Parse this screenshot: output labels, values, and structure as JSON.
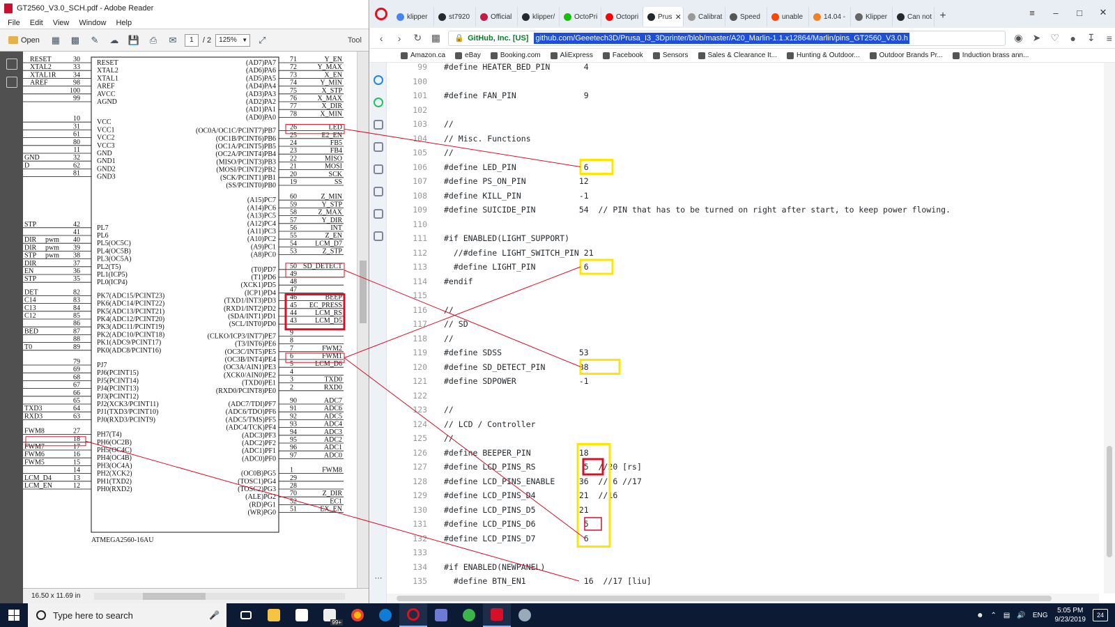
{
  "reader": {
    "title": "GT2560_V3.0_SCH.pdf - Adobe Reader",
    "menu": [
      "File",
      "Edit",
      "View",
      "Window",
      "Help"
    ],
    "open_label": "Open",
    "page_current": "1",
    "page_total": "/ 2",
    "zoom": "125%",
    "tools_label": "Tool",
    "page_size": "16.50 x 11.69 in",
    "chip_label": "ATMEGA2560-16AU",
    "left_pins": [
      {
        "num": "30",
        "name": "RESET"
      },
      {
        "num": "33",
        "name": "XTAL2"
      },
      {
        "num": "34",
        "name": "XTAL1"
      },
      {
        "num": "98",
        "name": "AREF"
      },
      {
        "num": "100",
        "name": "AVCC"
      },
      {
        "num": "99",
        "name": "AGND"
      },
      {
        "num": "10",
        "name": "VCC"
      },
      {
        "num": "31",
        "name": "VCC1"
      },
      {
        "num": "61",
        "name": "VCC2"
      },
      {
        "num": "80",
        "name": "VCC3"
      },
      {
        "num": "11",
        "name": "GND"
      },
      {
        "num": "32",
        "name": "GND1"
      },
      {
        "num": "62",
        "name": "GND2"
      },
      {
        "num": "81",
        "name": "GND3"
      },
      {
        "num": "42",
        "name": "PL7"
      },
      {
        "num": "41",
        "name": "PL6"
      },
      {
        "num": "40",
        "name": "PL5(OC5C)"
      },
      {
        "num": "39",
        "name": "PL4(OC5B)"
      },
      {
        "num": "38",
        "name": "PL3(OC5A)"
      },
      {
        "num": "37",
        "name": "PL2(T5)"
      },
      {
        "num": "36",
        "name": "PL1(ICP5)"
      },
      {
        "num": "35",
        "name": "PL0(ICP4)"
      },
      {
        "num": "82",
        "name": "PK7(ADC15/PCINT23)"
      },
      {
        "num": "83",
        "name": "PK6(ADC14/PCINT22)"
      },
      {
        "num": "84",
        "name": "PK5(ADC13/PCINT21)"
      },
      {
        "num": "85",
        "name": "PK4(ADC12/PCINT20)"
      },
      {
        "num": "86",
        "name": "PK3(ADC11/PCINT19)"
      },
      {
        "num": "87",
        "name": "PK2(ADC10/PCINT18)"
      },
      {
        "num": "88",
        "name": "PK1(ADC9/PCINT17)"
      },
      {
        "num": "89",
        "name": "PK0(ADC8/PCINT16)"
      },
      {
        "num": "79",
        "name": "PJ7"
      },
      {
        "num": "69",
        "name": "PJ6(PCINT15)"
      },
      {
        "num": "68",
        "name": "PJ5(PCINT14)"
      },
      {
        "num": "67",
        "name": "PJ4(PCINT13)"
      },
      {
        "num": "66",
        "name": "PJ3(PCINT12)"
      },
      {
        "num": "65",
        "name": "PJ2(XCK3/PCINT11)"
      },
      {
        "num": "64",
        "name": "PJ1(TXD3/PCINT10)"
      },
      {
        "num": "63",
        "name": "PJ0(RXD3/PCINT9)"
      },
      {
        "num": "27",
        "name": "PH7(T4)"
      },
      {
        "num": "18",
        "name": "PH6(OC2B)"
      },
      {
        "num": "17",
        "name": "PH5(OC4C)"
      },
      {
        "num": "16",
        "name": "PH4(OC4B)"
      },
      {
        "num": "15",
        "name": "PH3(OC4A)"
      },
      {
        "num": "14",
        "name": "PH2(XCK2)"
      },
      {
        "num": "13",
        "name": "PH1(TXD2)"
      },
      {
        "num": "12",
        "name": "PH0(RXD2)"
      }
    ],
    "far_left_labels": [
      "RESET",
      "XTAL2",
      "XTAL1R",
      "AREF",
      "GND",
      "D",
      "STP",
      "DIR",
      "DIR",
      "STP",
      "DIR",
      "EN",
      "STP",
      "DET",
      "C14",
      "C13",
      "C12",
      "BED",
      "T0",
      "TXD3",
      "RXD3",
      "FWM8",
      "FWM7",
      "FWM6",
      "FWM5",
      "LCM_D4",
      "LCM_EN"
    ],
    "pwm_labels": [
      "pwm",
      "pwm",
      "pwm"
    ],
    "right_pins": [
      {
        "num": "71",
        "name": "(AD7)PA7",
        "net": "Y_EN"
      },
      {
        "num": "72",
        "name": "(AD6)PA6",
        "net": "Y_MAX"
      },
      {
        "num": "73",
        "name": "(AD5)PA5",
        "net": "X_EN"
      },
      {
        "num": "74",
        "name": "(AD4)PA4",
        "net": "Y_MIN"
      },
      {
        "num": "75",
        "name": "(AD3)PA3",
        "net": "X_STP"
      },
      {
        "num": "76",
        "name": "(AD2)PA2",
        "net": "X_MAX"
      },
      {
        "num": "77",
        "name": "(AD1)PA1",
        "net": "X_DIR"
      },
      {
        "num": "78",
        "name": "(AD0)PA0",
        "net": "X_MIN"
      },
      {
        "num": "26",
        "name": "(OC0A/OC1C/PCINT7)PB7",
        "net": "LED"
      },
      {
        "num": "25",
        "name": "(OC1B/PCINT6)PB6",
        "net": "E2_EN"
      },
      {
        "num": "24",
        "name": "(OC1A/PCINT5)PB5",
        "net": "FB5"
      },
      {
        "num": "23",
        "name": "(OC2A/PCINT4)PB4",
        "net": "FB4"
      },
      {
        "num": "22",
        "name": "(MISO/PCINT3)PB3",
        "net": "MISO"
      },
      {
        "num": "21",
        "name": "(MOSI/PCINT2)PB2",
        "net": "MOSI"
      },
      {
        "num": "20",
        "name": "(SCK/PCINT1)PB1",
        "net": "SCK"
      },
      {
        "num": "19",
        "name": "(SS/PCINT0)PB0",
        "net": "SS"
      },
      {
        "num": "60",
        "name": "(A15)PC7",
        "net": "Z_MIN"
      },
      {
        "num": "59",
        "name": "(A14)PC6",
        "net": "Y_STP"
      },
      {
        "num": "58",
        "name": "(A13)PC5",
        "net": "Z_MAX"
      },
      {
        "num": "57",
        "name": "(A12)PC4",
        "net": "Y_DIR"
      },
      {
        "num": "56",
        "name": "(A11)PC3",
        "net": "INT"
      },
      {
        "num": "55",
        "name": "(A10)PC2",
        "net": "Z_EN"
      },
      {
        "num": "54",
        "name": "(A9)PC1",
        "net": "LCM_D7"
      },
      {
        "num": "53",
        "name": "(A8)PC0",
        "net": "Z_STP"
      },
      {
        "num": "50",
        "name": "(T0)PD7",
        "net": "SD_DETECT"
      },
      {
        "num": "49",
        "name": "(T1)PD6",
        "net": ""
      },
      {
        "num": "48",
        "name": "(XCK1)PD5",
        "net": ""
      },
      {
        "num": "47",
        "name": "(ICP1)PD4",
        "net": ""
      },
      {
        "num": "46",
        "name": "(TXD1/INT3)PD3",
        "net": "BEEP"
      },
      {
        "num": "45",
        "name": "(RXD1/INT2)PD2",
        "net": "EC_PRESS"
      },
      {
        "num": "44",
        "name": "(SDA/INT1)PD1",
        "net": "LCM_RS"
      },
      {
        "num": "43",
        "name": "(SCL/INT0)PD0",
        "net": "LCM_D5"
      },
      {
        "num": "9",
        "name": "(CLKO/ICP3/INT7)PE7",
        "net": ""
      },
      {
        "num": "8",
        "name": "(T3/INT6)PE6",
        "net": ""
      },
      {
        "num": "7",
        "name": "(OC3C/INT5)PE5",
        "net": "FWM2"
      },
      {
        "num": "6",
        "name": "(OC3B/INT4)PE4",
        "net": "FWM1"
      },
      {
        "num": "5",
        "name": "(OC3A/AIN1)PE3",
        "net": "LCM_D6"
      },
      {
        "num": "4",
        "name": "(XCK0/AIN0)PE2",
        "net": ""
      },
      {
        "num": "3",
        "name": "(TXD0)PE1",
        "net": "TXD0"
      },
      {
        "num": "2",
        "name": "(RXD0/PCINT8)PE0",
        "net": "RXD0"
      },
      {
        "num": "90",
        "name": "(ADC7/TDI)PF7",
        "net": "ADC7"
      },
      {
        "num": "91",
        "name": "(ADC6/TDO)PF6",
        "net": "ADC6"
      },
      {
        "num": "92",
        "name": "(ADC5/TMS)PF5",
        "net": "ADC5"
      },
      {
        "num": "93",
        "name": "(ADC4/TCK)PF4",
        "net": "ADC4"
      },
      {
        "num": "94",
        "name": "(ADC3)PF3",
        "net": "ADC3"
      },
      {
        "num": "95",
        "name": "(ADC2)PF2",
        "net": "ADC2"
      },
      {
        "num": "96",
        "name": "(ADC1)PF1",
        "net": "ADC1"
      },
      {
        "num": "97",
        "name": "(ADC0)PF0",
        "net": "ADC0"
      },
      {
        "num": "1",
        "name": "(OC0B)PG5",
        "net": "FWM8"
      },
      {
        "num": "29",
        "name": "(TOSC1)PG4",
        "net": ""
      },
      {
        "num": "28",
        "name": "(TOSC2)PG3",
        "net": ""
      },
      {
        "num": "70",
        "name": "(ALE)PG2",
        "net": "Z_DIR"
      },
      {
        "num": "52",
        "name": "(RD)PG1",
        "net": "EC1"
      },
      {
        "num": "51",
        "name": "(WR)PG0",
        "net": "EX_EN"
      }
    ]
  },
  "browser": {
    "tabs": [
      {
        "label": "klipper",
        "color": "#4285f4"
      },
      {
        "label": "st7920",
        "color": "#24292e"
      },
      {
        "label": "Official",
        "color": "#c51a4a"
      },
      {
        "label": "klipper/",
        "color": "#24292e"
      },
      {
        "label": "OctoPri",
        "color": "#13c100"
      },
      {
        "label": "Octopri",
        "color": "#ff0000"
      },
      {
        "label": "Prus",
        "color": "#24292e",
        "active": true
      },
      {
        "label": "Calibrat",
        "color": "#999999"
      },
      {
        "label": "Speed",
        "color": "#555555"
      },
      {
        "label": "unable",
        "color": "#ff4500"
      },
      {
        "label": "14.04 -",
        "color": "#f48024"
      },
      {
        "label": "Klipper",
        "color": "#666666"
      },
      {
        "label": "Can not",
        "color": "#24292e"
      }
    ],
    "cert_label": "GitHub, Inc. [US]",
    "url": "github.com/Geeetech3D/Prusa_I3_3Dprinter/blob/master/A20_Marlin-1.1.x12864/Marlin/pins_GT2560_V3.0.h",
    "bookmarks": [
      "Amazon.ca",
      "eBay",
      "Booking.com",
      "AliExpress",
      "Facebook",
      "Sensors",
      "Sales & Clearance It...",
      "Hunting & Outdoor...",
      "Outdoor Brands Pr...",
      "Induction brass ann..."
    ],
    "code_lines": [
      {
        "n": "99",
        "text": "#define HEATER_BED_PIN       4"
      },
      {
        "n": "100",
        "text": ""
      },
      {
        "n": "101",
        "text": "#define FAN_PIN              9"
      },
      {
        "n": "102",
        "text": ""
      },
      {
        "n": "103",
        "text": "//"
      },
      {
        "n": "104",
        "text": "// Misc. Functions"
      },
      {
        "n": "105",
        "text": "//"
      },
      {
        "n": "106",
        "text": "#define LED_PIN              6"
      },
      {
        "n": "107",
        "text": "#define PS_ON_PIN           12"
      },
      {
        "n": "108",
        "text": "#define KILL_PIN            -1"
      },
      {
        "n": "109",
        "text": "#define SUICIDE_PIN         54  // PIN that has to be turned on right after start, to keep power flowing."
      },
      {
        "n": "110",
        "text": ""
      },
      {
        "n": "111",
        "text": "#if ENABLED(LIGHT_SUPPORT)"
      },
      {
        "n": "112",
        "text": "  //#define LIGHT_SWITCH_PIN 21"
      },
      {
        "n": "113",
        "text": "  #define LIGHT_PIN          6"
      },
      {
        "n": "114",
        "text": "#endif"
      },
      {
        "n": "115",
        "text": ""
      },
      {
        "n": "116",
        "text": "//"
      },
      {
        "n": "117",
        "text": "// SD"
      },
      {
        "n": "118",
        "text": "//"
      },
      {
        "n": "119",
        "text": "#define SDSS                53"
      },
      {
        "n": "120",
        "text": "#define SD_DETECT_PIN       38"
      },
      {
        "n": "121",
        "text": "#define SDPOWER             -1"
      },
      {
        "n": "122",
        "text": ""
      },
      {
        "n": "123",
        "text": "//"
      },
      {
        "n": "124",
        "text": "// LCD / Controller"
      },
      {
        "n": "125",
        "text": "//"
      },
      {
        "n": "126",
        "text": "#define BEEPER_PIN          18"
      },
      {
        "n": "127",
        "text": "#define LCD_PINS_RS          5  //20 [rs]"
      },
      {
        "n": "128",
        "text": "#define LCD_PINS_ENABLE     36  // 6 //17"
      },
      {
        "n": "129",
        "text": "#define LCD_PINS_D4         21  //16"
      },
      {
        "n": "130",
        "text": "#define LCD_PINS_D5         21"
      },
      {
        "n": "131",
        "text": "#define LCD_PINS_D6          5"
      },
      {
        "n": "132",
        "text": "#define LCD_PINS_D7          6"
      },
      {
        "n": "133",
        "text": ""
      },
      {
        "n": "134",
        "text": "#if ENABLED(NEWPANEL)"
      },
      {
        "n": "135",
        "text": "  #define BTN_EN1            16  //17 [liu]"
      }
    ]
  },
  "taskbar": {
    "search_placeholder": "Type here to search",
    "lang": "ENG",
    "time": "5:05 PM",
    "date": "9/23/2019",
    "notifications": "24",
    "mail_badge": "99+"
  },
  "colors": {
    "highlight_yellow": "#ffe600",
    "highlight_red": "#d7102a",
    "url_selection": "#1d4fd8",
    "opera_red": "#e0101c",
    "taskbar_bg": "#0c1a33"
  }
}
